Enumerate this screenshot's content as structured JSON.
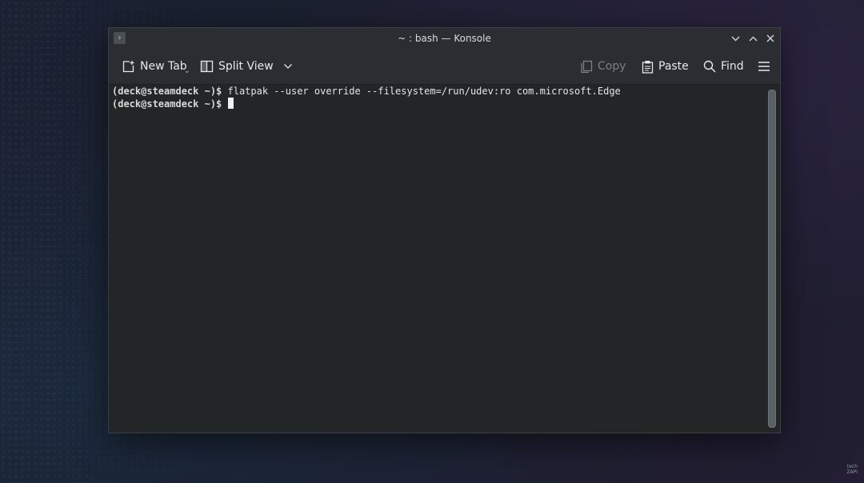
{
  "window": {
    "title": "~ : bash — Konsole"
  },
  "toolbar": {
    "new_tab_label": "New Tab",
    "split_view_label": "Split View",
    "copy_label": "Copy",
    "paste_label": "Paste",
    "find_label": "Find"
  },
  "terminal": {
    "lines": [
      {
        "prompt": "(deck@steamdeck ~)$",
        "command": " flatpak --user override --filesystem=/run/udev:ro com.microsoft.Edge"
      },
      {
        "prompt": "(deck@steamdeck ~)$",
        "command": " "
      }
    ]
  },
  "watermark": {
    "line1": "tech",
    "line2": "ZAPI"
  },
  "colors": {
    "terminal_bg": "#232627",
    "chrome_bg": "#2a2e32",
    "text": "#e3e5e7",
    "disabled_text": "#7b8086"
  }
}
